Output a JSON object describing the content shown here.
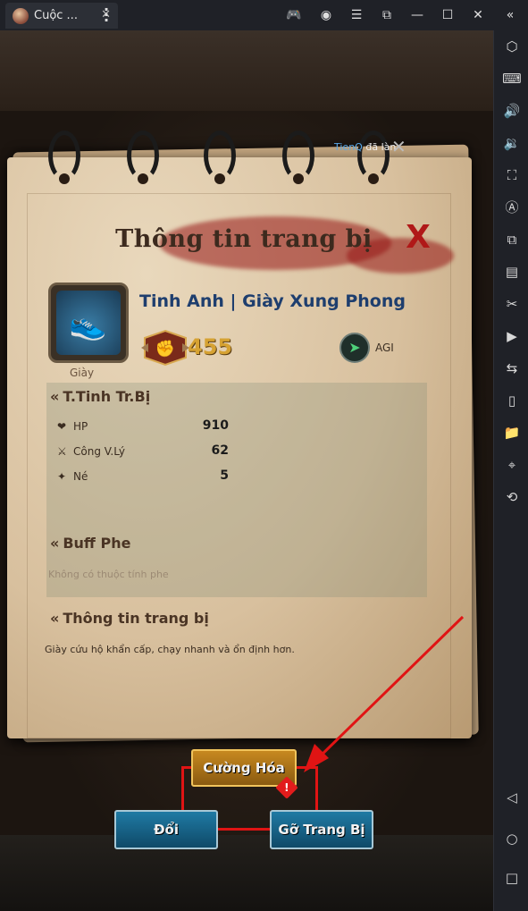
{
  "window": {
    "tab_title": "Cuộc ...",
    "tab_close": "✕"
  },
  "panel": {
    "title": "Thông tin trang bị",
    "close_label": "X",
    "chat_name": "TienQ",
    "chat_text": "đã làn"
  },
  "item": {
    "type": "Giày",
    "name": "Tinh Anh | Giày Xung Phong",
    "power": "455",
    "attribute": "AGI"
  },
  "sections": {
    "stats_title": "T.Tinh Tr.Bị",
    "buff_title": "Buff Phe",
    "info_title": "Thông tin trang bị"
  },
  "stats": [
    {
      "label": "HP",
      "value": "910"
    },
    {
      "label": "Công V.Lý",
      "value": "62"
    },
    {
      "label": "Né",
      "value": "5"
    }
  ],
  "no_faction_text": "Không có thuộc tính phe",
  "description": "Giày cứu hộ khẩn cấp, chạy nhanh và ổn định hơn.",
  "buttons": {
    "enhance": "Cường Hóa",
    "swap": "Đổi",
    "unequip": "Gỡ Trang Bị"
  },
  "warning_glyph": "!"
}
